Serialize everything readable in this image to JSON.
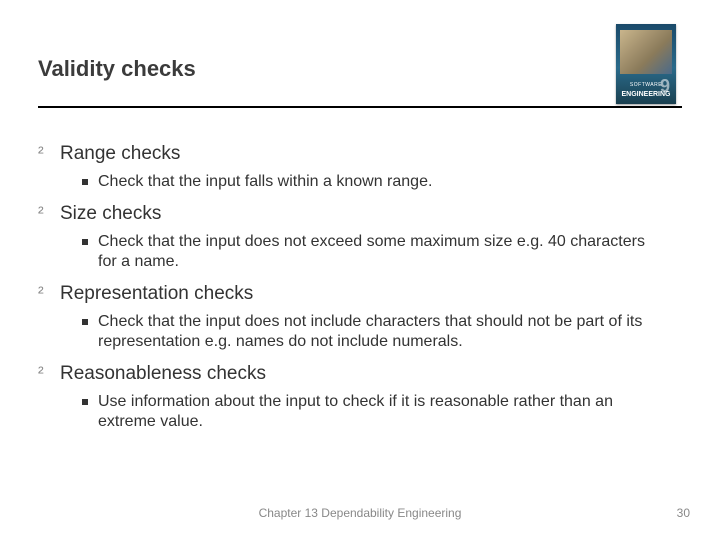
{
  "title": "Validity checks",
  "book": {
    "line1": "SOFTWARE",
    "line2": "ENGINEERING",
    "edition": "9"
  },
  "items": [
    {
      "heading": "Range checks",
      "sub": "Check that the input falls within a known range."
    },
    {
      "heading": "Size checks",
      "sub": "Check that the input does not exceed some maximum size e.g. 40 characters for a name."
    },
    {
      "heading": "Representation checks",
      "sub": "Check that the input does not include characters that should not be part of its representation e.g. names do not include numerals."
    },
    {
      "heading": "Reasonableness checks",
      "sub": "Use information about the input to check if it is reasonable rather than an extreme value."
    }
  ],
  "footer": {
    "center": "Chapter 13 Dependability Engineering",
    "page": "30"
  },
  "glyphs": {
    "diamond": "²"
  }
}
